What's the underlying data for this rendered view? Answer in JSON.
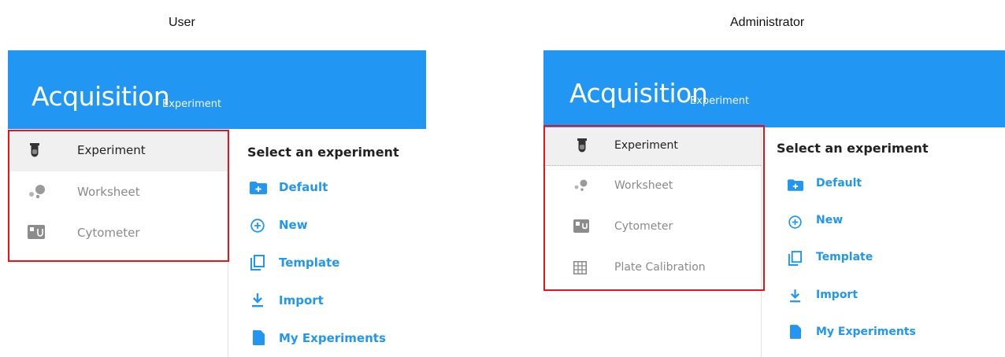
{
  "captions": {
    "user": "User",
    "admin": "Administrator"
  },
  "colors": {
    "accent": "#2196f3",
    "highlight": "#e8141a"
  },
  "user_panel": {
    "header": {
      "title": "Acquisition",
      "subtitle": "Experiment"
    },
    "nav": [
      {
        "label": "Experiment",
        "icon": "test-tube-icon",
        "active": true
      },
      {
        "label": "Worksheet",
        "icon": "dots-icon",
        "active": false
      },
      {
        "label": "Cytometer",
        "icon": "cytometer-icon",
        "active": false
      }
    ],
    "content": {
      "heading": "Select an experiment",
      "actions": [
        {
          "label": "Default",
          "icon": "folder-plus-icon"
        },
        {
          "label": "New",
          "icon": "circle-plus-icon"
        },
        {
          "label": "Template",
          "icon": "copy-icon"
        },
        {
          "label": "Import",
          "icon": "download-icon"
        },
        {
          "label": "My Experiments",
          "icon": "document-icon"
        }
      ]
    }
  },
  "admin_panel": {
    "header": {
      "title": "Acquisition",
      "subtitle": "Experiment"
    },
    "nav": [
      {
        "label": "Experiment",
        "icon": "test-tube-icon",
        "active": true
      },
      {
        "label": "Worksheet",
        "icon": "dots-icon",
        "active": false
      },
      {
        "label": "Cytometer",
        "icon": "cytometer-icon",
        "active": false
      },
      {
        "label": "Plate Calibration",
        "icon": "grid-icon",
        "active": false
      }
    ],
    "content": {
      "heading": "Select an experiment",
      "actions": [
        {
          "label": "Default",
          "icon": "folder-plus-icon"
        },
        {
          "label": "New",
          "icon": "circle-plus-icon"
        },
        {
          "label": "Template",
          "icon": "copy-icon"
        },
        {
          "label": "Import",
          "icon": "download-icon"
        },
        {
          "label": "My Experiments",
          "icon": "document-icon"
        }
      ]
    }
  }
}
